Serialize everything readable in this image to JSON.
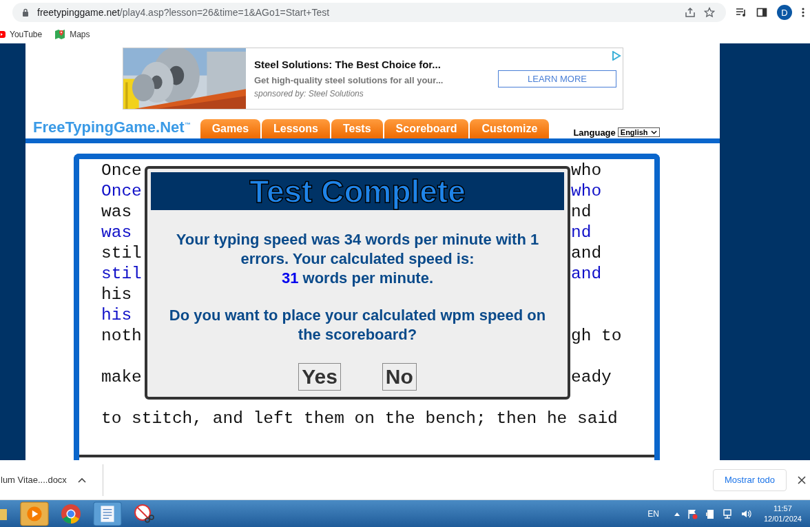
{
  "browser": {
    "url_host": "freetypinggame.net",
    "url_path": "/play4.asp?lesson=26&time=1&AGo1=Start+Test",
    "avatar": "D",
    "bookmarks": [
      {
        "label": "YouTube",
        "kind": "youtube"
      },
      {
        "label": "Maps",
        "kind": "maps"
      }
    ]
  },
  "ad": {
    "headline": "Steel Solutions: The Best Choice for...",
    "text": "Get high-quality steel solutions for all your...",
    "sponsor": "sponsored by: Steel Solutions",
    "button": "LEARN MORE"
  },
  "site": {
    "logo": "FreeTypingGame.Net",
    "logo_mark": "™",
    "nav": [
      "Games",
      "Lessons",
      "Tests",
      "Scoreboard",
      "Customize"
    ],
    "language_label": "Language",
    "language_value": "English"
  },
  "typing_lines": [
    {
      "kind": "source",
      "left": "Once",
      "right": "who"
    },
    {
      "kind": "typed",
      "left": "Once",
      "right": "who"
    },
    {
      "kind": "source",
      "left": "was",
      "right": "nd"
    },
    {
      "kind": "typed",
      "left": "was",
      "right": "nd"
    },
    {
      "kind": "source",
      "left": "stil",
      "right": "and"
    },
    {
      "kind": "typed",
      "left": "stil",
      "right": "and"
    },
    {
      "kind": "source",
      "left": "his"
    },
    {
      "kind": "typed",
      "left": "his"
    },
    {
      "kind": "source",
      "left": "noth",
      "right": "gh to"
    },
    {
      "kind": "blank"
    },
    {
      "kind": "source",
      "left": "make",
      "right": "eady"
    },
    {
      "kind": "blank"
    },
    {
      "kind": "source",
      "left": "to stitch, and left them on the bench; then he said"
    }
  ],
  "dialog": {
    "title": "Test Complete",
    "message": "Your typing speed was 34 words per minute with 1 errors. Your calculated speed is:",
    "speed_value": "31",
    "speed_unit": "words per minute.",
    "question": "Do you want to place your calculated wpm speed on the scoreboard?",
    "buttons": [
      "Yes",
      "No"
    ]
  },
  "downloads": {
    "file": "lum Vitae....docx",
    "show_all": "Mostrar todo"
  },
  "taskbar": {
    "language": "EN",
    "time": "11:57",
    "date": "12/01/2024"
  }
}
